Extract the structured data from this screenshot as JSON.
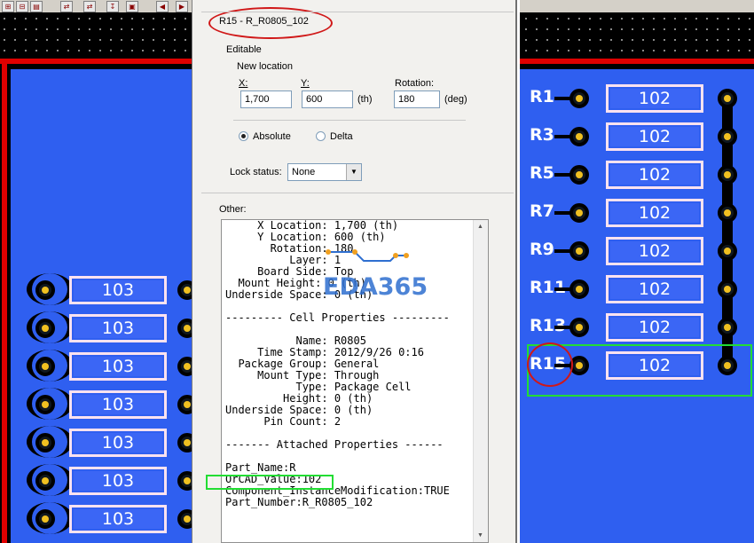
{
  "panel": {
    "component_title": "R15 - R_R0805_102",
    "editable_label": "Editable",
    "new_location_label": "New location",
    "x_label": "X:",
    "y_label": "Y:",
    "rotation_label": "Rotation:",
    "x_value": "1,700",
    "y_value": "600",
    "x_unit": "(th)",
    "rotation_value": "180",
    "rotation_unit": "(deg)",
    "absolute_label": "Absolute",
    "delta_label": "Delta",
    "lock_label": "Lock status:",
    "lock_value": "None",
    "other_label": "Other:",
    "other_lines": [
      "     X Location: 1,700 (th)",
      "     Y Location: 600 (th)",
      "       Rotation: 180",
      "          Layer: 1",
      "     Board Side: Top",
      "  Mount Height: 0 (th)",
      "Underside Space: 0 (th)",
      "",
      "--------- Cell Properties ---------",
      "",
      "           Name: R0805",
      "     Time Stamp: 2012/9/26 0:16",
      "  Package Group: General",
      "     Mount Type: Through",
      "           Type: Package Cell",
      "         Height: 0 (th)",
      "Underside Space: 0 (th)",
      "      Pin Count: 2",
      "",
      "------- Attached Properties ------",
      "",
      "Part_Name:R",
      "OrCAD_Value:102",
      "Component_InstanceModification:TRUE",
      "Part_Number:R_R0805_102"
    ]
  },
  "board": {
    "right_refs": [
      "R1",
      "R3",
      "R5",
      "R7",
      "R9",
      "R11",
      "R13",
      "R15"
    ],
    "right_value": "102",
    "left_value": "103",
    "left_count": 7
  },
  "watermark": "EDA365",
  "colors": {
    "copper": "#2f5ff0",
    "rail": "#e00000",
    "selection": "#22dd33",
    "annotation": "#d01818"
  }
}
